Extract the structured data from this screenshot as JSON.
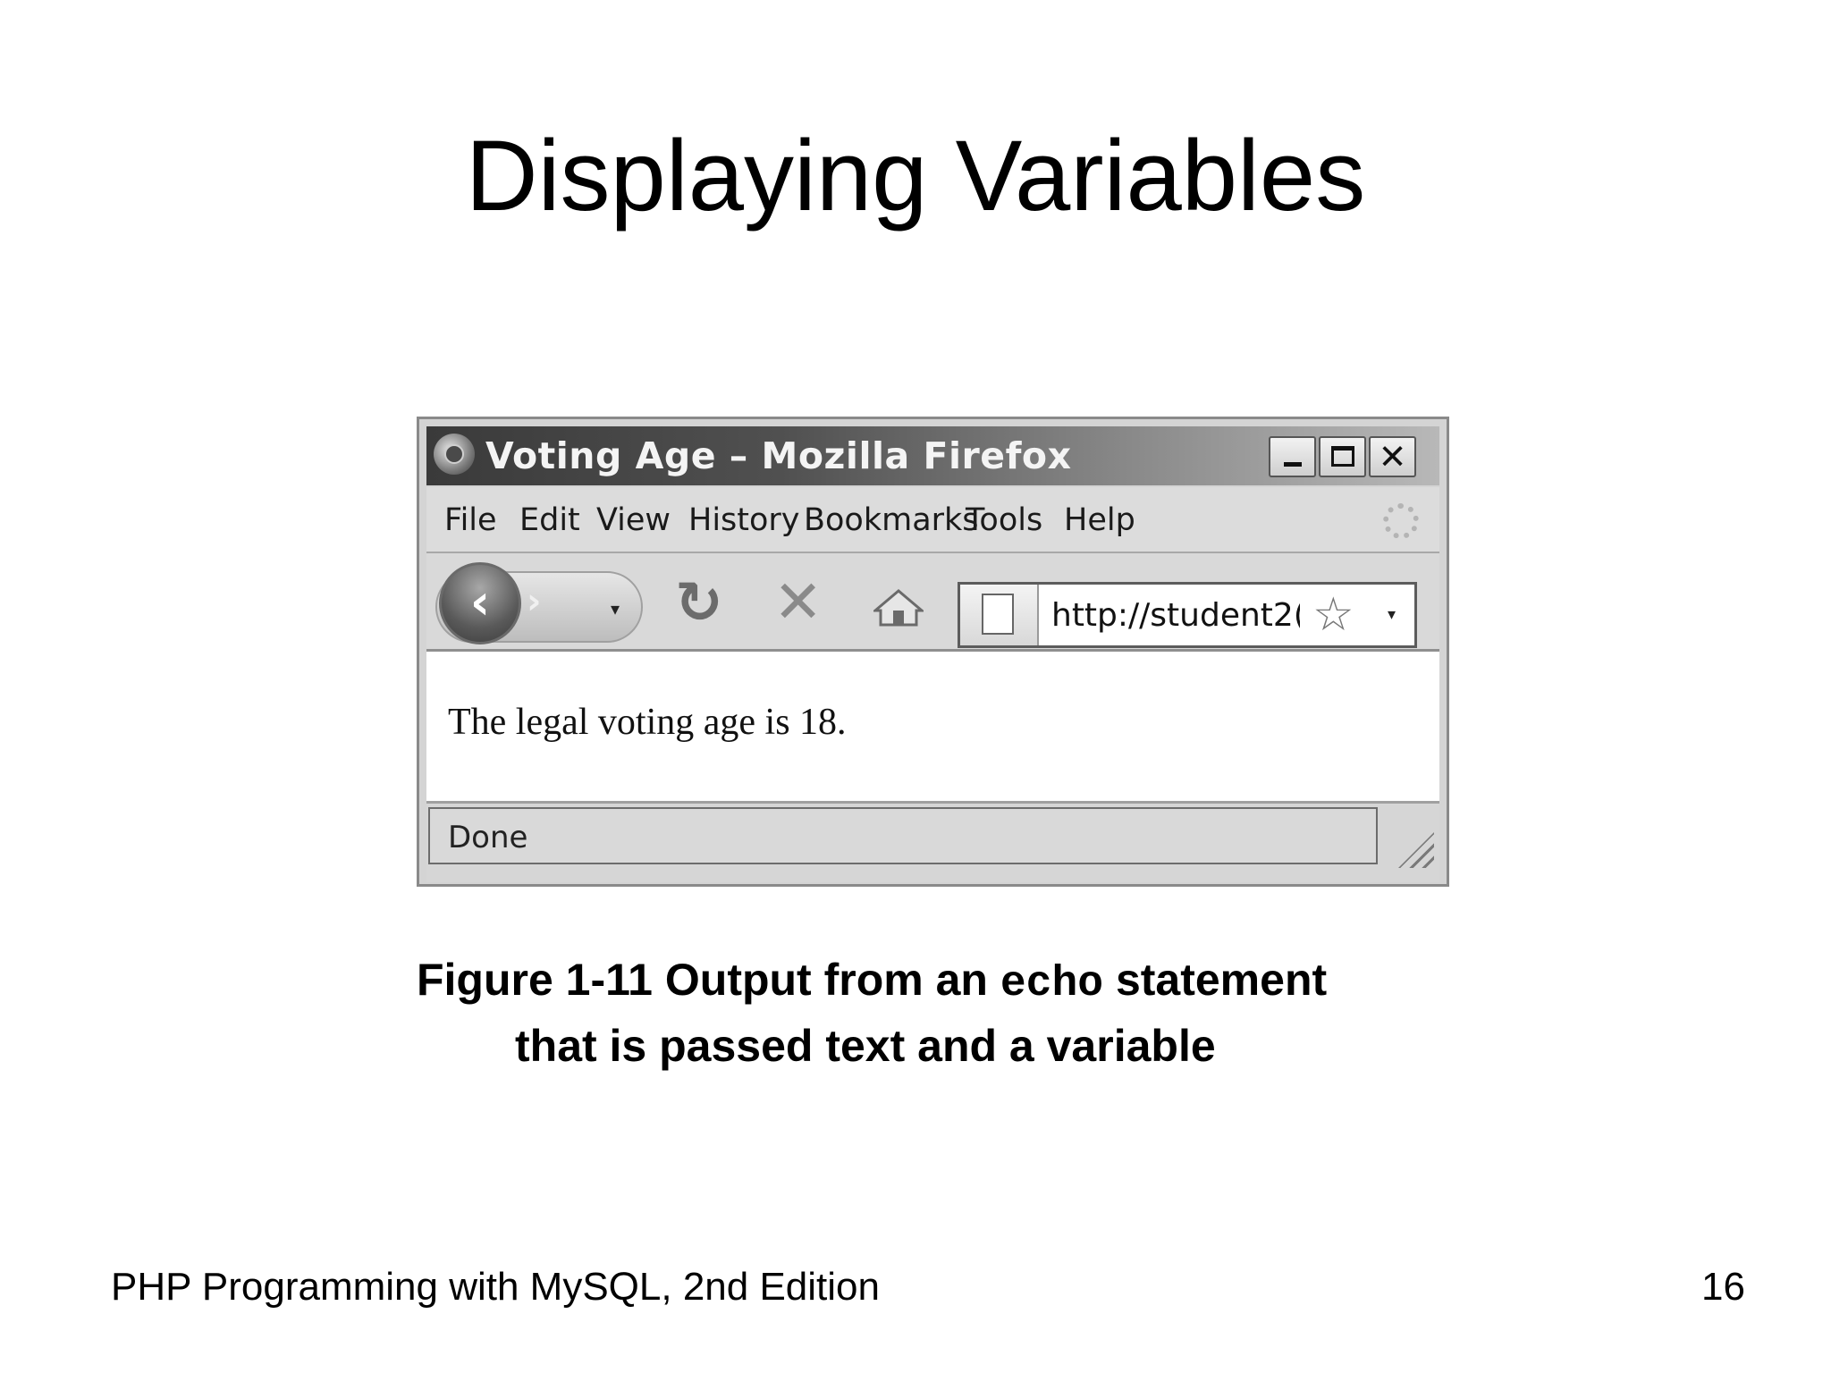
{
  "slide": {
    "title": "Displaying Variables",
    "caption_line1_prefix": "Figure 1-11 Output from an ",
    "caption_code": "echo",
    "caption_line1_suffix": " statement",
    "caption_line2": "that is passed text and a variable",
    "footer_left": "PHP Programming with MySQL, 2nd Edition",
    "page_number": "16"
  },
  "browser": {
    "window_title": "Voting Age – Mozilla Firefox",
    "window_buttons": {
      "minimize": "_",
      "close": "✕"
    },
    "menu": [
      "File",
      "Edit",
      "View",
      "History",
      "Bookmarks",
      "Tools",
      "Help"
    ],
    "url": "http://student2(",
    "page_text": "The legal voting age is 18.",
    "status": "Done",
    "icons": {
      "app": "firefox-icon",
      "back": "back-arrow-icon",
      "forward": "forward-arrow-icon",
      "reload": "reload-icon",
      "stop": "stop-icon",
      "home": "home-icon",
      "page": "page-icon",
      "bookmark": "star-icon",
      "throbber": "spinner-icon"
    },
    "glyphs": {
      "back": "‹",
      "forward": "›",
      "dropdown": "▾",
      "reload": "↻",
      "stop": "✕",
      "star": "☆"
    }
  }
}
